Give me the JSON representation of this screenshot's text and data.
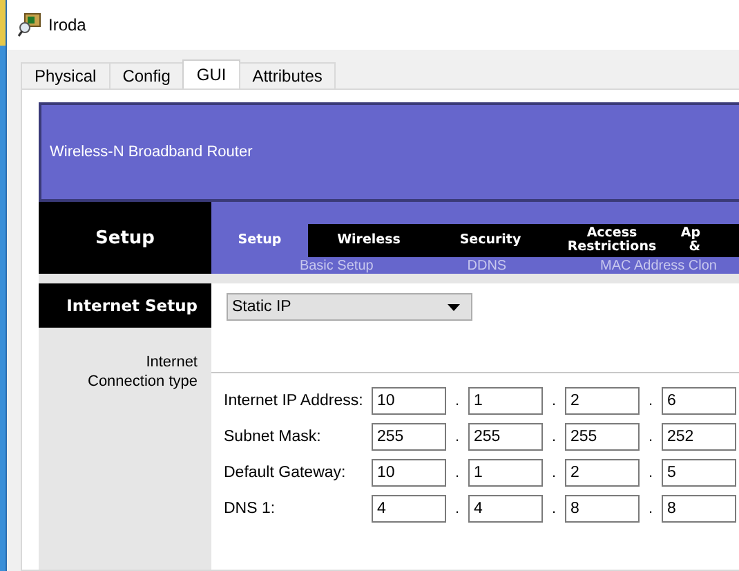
{
  "window": {
    "title": "Iroda"
  },
  "tabs": [
    {
      "label": "Physical",
      "selected": false
    },
    {
      "label": "Config",
      "selected": false
    },
    {
      "label": "GUI",
      "selected": true
    },
    {
      "label": "Attributes",
      "selected": false
    }
  ],
  "banner": {
    "title": "Wireless-N Broadband Router"
  },
  "section": {
    "title": "Setup"
  },
  "nav": [
    {
      "label": "Setup",
      "selected": true
    },
    {
      "label": "Wireless",
      "selected": false
    },
    {
      "label": "Security",
      "selected": false
    },
    {
      "label": "Access Restrictions",
      "selected": false
    },
    {
      "label": "Ap &",
      "selected": false
    }
  ],
  "subnav": [
    "Basic Setup",
    "DDNS",
    "MAC Address Clon"
  ],
  "sidebar": {
    "heading": "Internet Setup",
    "label": "Internet Connection type"
  },
  "connection_type": {
    "value": "Static IP"
  },
  "octet_separator": ".",
  "fields": [
    {
      "label": "Internet IP Address:",
      "octets": [
        "10",
        "1",
        "2",
        "6"
      ]
    },
    {
      "label": "Subnet Mask:",
      "octets": [
        "255",
        "255",
        "255",
        "252"
      ]
    },
    {
      "label": "Default Gateway:",
      "octets": [
        "10",
        "1",
        "2",
        "5"
      ]
    },
    {
      "label": "DNS 1:",
      "octets": [
        "4",
        "4",
        "8",
        "8"
      ]
    }
  ]
}
